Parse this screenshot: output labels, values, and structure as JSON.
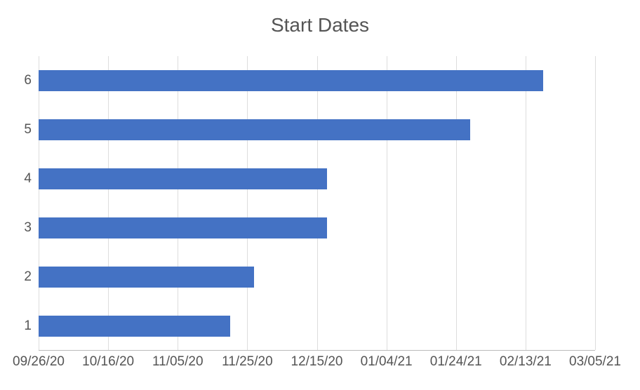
{
  "chart_data": {
    "type": "bar",
    "title": "Start Dates",
    "orientation": "horizontal",
    "categories": [
      "1",
      "2",
      "3",
      "4",
      "5",
      "6"
    ],
    "values_as_dates": [
      "11/20/20",
      "11/27/20",
      "12/18/20",
      "12/18/20",
      "01/28/21",
      "02/18/21"
    ],
    "x_ticks": [
      "09/26/20",
      "10/16/20",
      "11/05/20",
      "11/25/20",
      "12/15/20",
      "01/04/21",
      "01/24/21",
      "02/13/21",
      "03/05/21"
    ],
    "x_tick_serial": [
      44100,
      44120,
      44140,
      44160,
      44180,
      44200,
      44220,
      44240,
      44260
    ],
    "values_serial": [
      44155,
      44162,
      44183,
      44183,
      44224,
      44245
    ],
    "xlim": [
      44100,
      44260
    ],
    "xlabel": "",
    "ylabel": "",
    "bar_color": "#4472c4"
  }
}
